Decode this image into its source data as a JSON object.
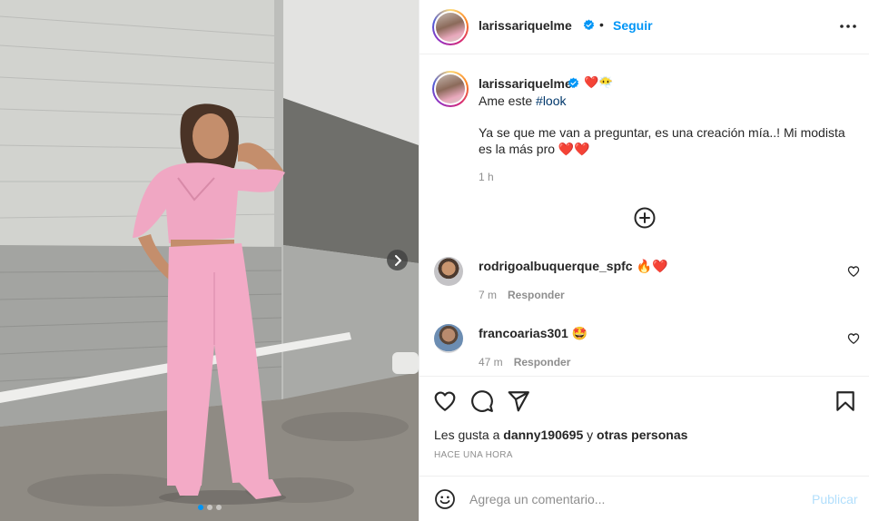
{
  "post": {
    "author": "larissariquelme",
    "follow_label": "Seguir",
    "separator": "•",
    "more_icon": "more-horizontal-icon"
  },
  "caption": {
    "username": "larissariquelme",
    "emoji": "❤️😶‍🌫️",
    "text_prefix": "Ame este ",
    "hashtag": "#look",
    "paragraph": "Ya se que me van a preguntar, es una creación mía..! Mi modista es la más pro ❤️❤️",
    "time": "1 h"
  },
  "load_more_icon": "plus-circle-icon",
  "comments": [
    {
      "username": "rodrigoalbuquerque_spfc",
      "emoji": "🔥❤️",
      "time": "7 m",
      "reply_label": "Responder"
    },
    {
      "username": "francoarias301",
      "emoji": "🤩",
      "time": "47 m",
      "reply_label": "Responder"
    }
  ],
  "actions": {
    "like_icon": "heart-icon",
    "comment_icon": "comment-icon",
    "share_icon": "send-icon",
    "save_icon": "bookmark-icon"
  },
  "likes": {
    "prefix": "Les gusta a ",
    "user": "danny190695",
    "middle": " y ",
    "suffix": "otras personas"
  },
  "time_ago": "HACE UNA HORA",
  "add_comment": {
    "placeholder": "Agrega un comentario...",
    "publish_label": "Publicar"
  },
  "carousel": {
    "count": 3,
    "active_index": 0
  },
  "colors": {
    "accent": "#0095f6",
    "verified": "#0095f6",
    "muted": "#8e8e8e",
    "publish_disabled": "#b2dffc"
  }
}
